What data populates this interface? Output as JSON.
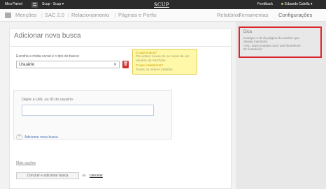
{
  "topbar": {
    "brand": "Meu Painel",
    "account": "Scup - Scup ▾",
    "logo": "SCUP",
    "feedback": "Feedback",
    "user": "Eduardo Calella ▾"
  },
  "navbar": {
    "items": [
      "Menções",
      "SAC 2.0",
      "Relacionamento",
      "Páginas e Perfis",
      "Relatórios",
      "Ferramentas",
      "Configurações"
    ]
  },
  "form": {
    "title": "Adicionar nova busca",
    "media_label": "Escolha a mídia social e o tipo de busca:",
    "media_selected": "Usuário",
    "help": {
      "q1": "O que busca?",
      "a1": "Os vídeos novos do no canal de um usuário do YouTube.",
      "q2": "O que coletamos?",
      "a2": "Todos os vídeos inéditos."
    },
    "url_label": "Digite a URL ou ID do usuário:",
    "url_value": "",
    "add_link": "Adicionar nova busca",
    "more_options": "Mais opções",
    "submit": "Concluir e adicionar busca",
    "or": "ou",
    "cancel": "cancelar"
  },
  "tip": {
    "title": "Dica",
    "lines": [
      "Coloque o ID da página do usuário que",
      "deseja monitorar.",
      "URL: www.youtube.com/ user/leotefever",
      "ID: leotefever"
    ]
  },
  "colors": {
    "tip_border": "#d9262c",
    "help_background": "#fff8a8",
    "topbar_background": "#2b2b2b"
  }
}
